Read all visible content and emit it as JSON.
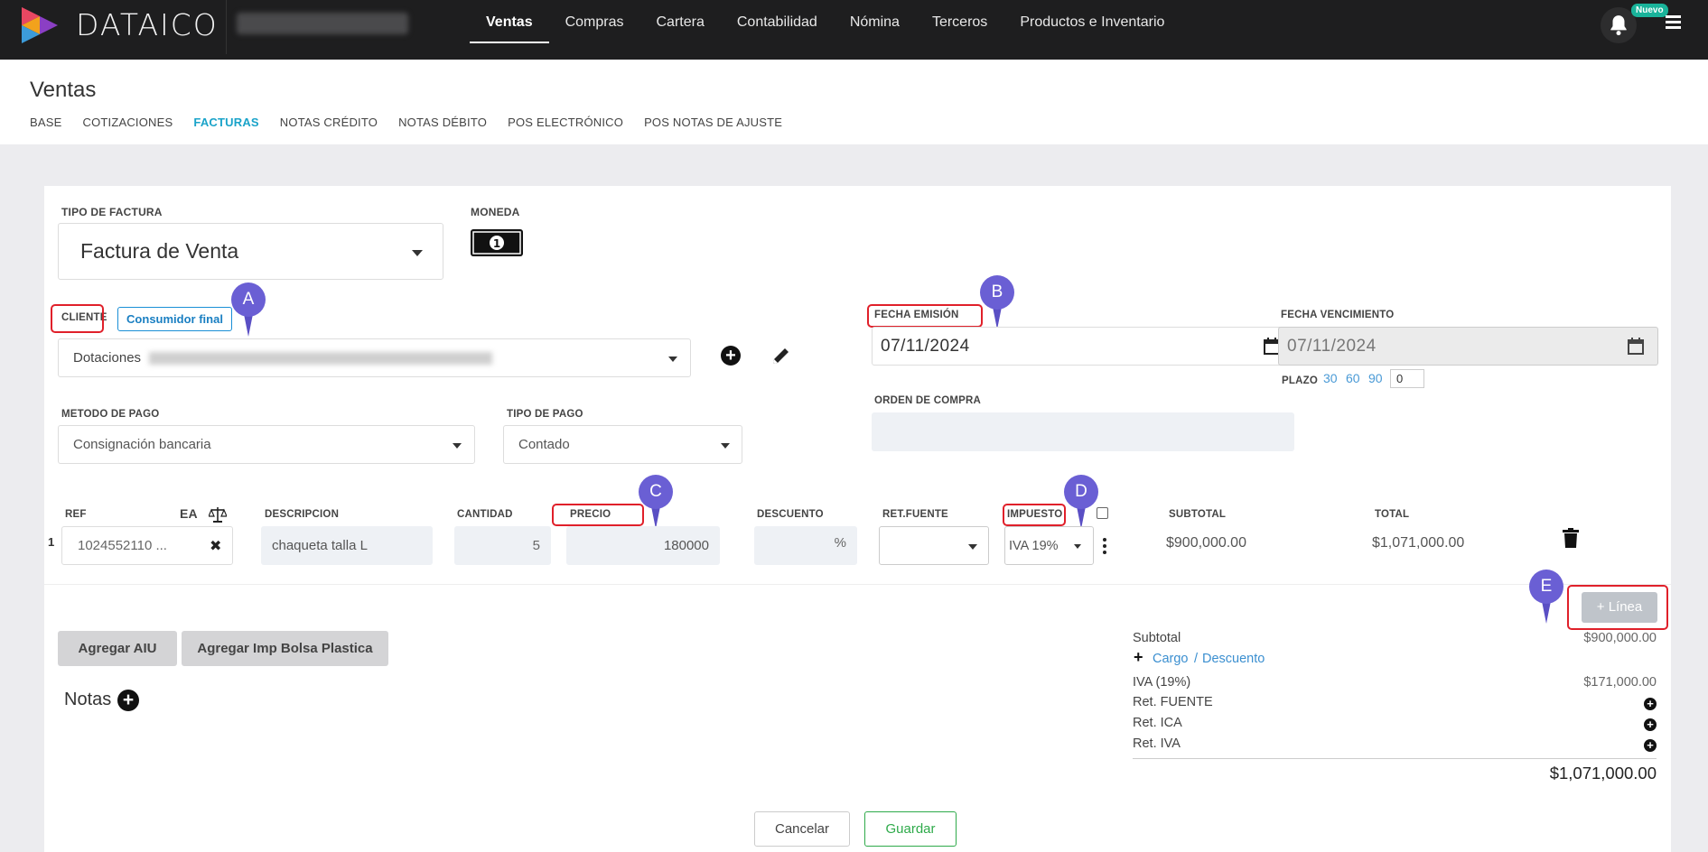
{
  "brand": {
    "name": "DATAICO"
  },
  "nav": {
    "items": [
      "Ventas",
      "Compras",
      "Cartera",
      "Contabilidad",
      "Nómina",
      "Terceros",
      "Productos e Inventario"
    ],
    "active": "Ventas"
  },
  "notifications": {
    "badge": "Nuevo"
  },
  "page": {
    "title": "Ventas",
    "tabs": [
      "BASE",
      "COTIZACIONES",
      "FACTURAS",
      "NOTAS CRÉDITO",
      "NOTAS DÉBITO",
      "POS ELECTRÓNICO",
      "POS NOTAS DE AJUSTE"
    ],
    "active_tab": "FACTURAS"
  },
  "form": {
    "tipo_factura_label": "TIPO DE FACTURA",
    "tipo_factura_value": "Factura de Venta",
    "moneda_label": "MONEDA",
    "cliente_label": "CLIENTE",
    "consumidor_final": "Consumidor final",
    "cliente_value": "Dotaciones",
    "fecha_emision_label": "FECHA EMISIÓN",
    "fecha_emision_value": "07/11/2024",
    "fecha_vencimiento_label": "FECHA VENCIMIENTO",
    "fecha_vencimiento_value": "07/11/2024",
    "plazo_label": "PLAZO",
    "plazo_options": [
      "30",
      "60",
      "90"
    ],
    "plazo_value": "0",
    "orden_compra_label": "ORDEN DE COMPRA",
    "metodo_pago_label": "METODO DE PAGO",
    "metodo_pago_value": "Consignación bancaria",
    "tipo_pago_label": "TIPO DE PAGO",
    "tipo_pago_value": "Contado"
  },
  "lines": {
    "headers": {
      "ref": "REF",
      "ea": "EA",
      "descripcion": "DESCRIPCION",
      "cantidad": "CANTIDAD",
      "precio": "PRECIO",
      "descuento": "DESCUENTO",
      "ret_fuente": "RET.FUENTE",
      "impuesto": "IMPUESTO",
      "subtotal": "SUBTOTAL",
      "total": "TOTAL"
    },
    "rows": [
      {
        "num": "1",
        "ref": "1024552110 ...",
        "descripcion": "chaqueta talla L",
        "cantidad": "5",
        "precio": "180000",
        "descuento_suffix": "%",
        "impuesto": "IVA 19%",
        "subtotal": "$900,000.00",
        "total": "$1,071,000.00"
      }
    ],
    "add_line": "+ Línea"
  },
  "buttons": {
    "agregar_aiu": "Agregar AIU",
    "agregar_bolsa": "Agregar Imp Bolsa Plastica",
    "notas": "Notas",
    "cancelar": "Cancelar",
    "guardar": "Guardar"
  },
  "totals": {
    "subtotal_label": "Subtotal",
    "subtotal_value": "$900,000.00",
    "cargo": "Cargo",
    "slash": "/",
    "descuento": "Descuento",
    "iva_label": "IVA (19%)",
    "iva_value": "$171,000.00",
    "ret_fuente": "Ret. FUENTE",
    "ret_ica": "Ret. ICA",
    "ret_iva": "Ret. IVA",
    "grand_total": "$1,071,000.00"
  },
  "annotations": {
    "a": "A",
    "b": "B",
    "c": "C",
    "d": "D",
    "e": "E"
  },
  "colors": {
    "accent": "#1aa3c9",
    "annotation": "#6a5fd4",
    "highlight": "#e0202a",
    "save": "#2eaa4a"
  }
}
